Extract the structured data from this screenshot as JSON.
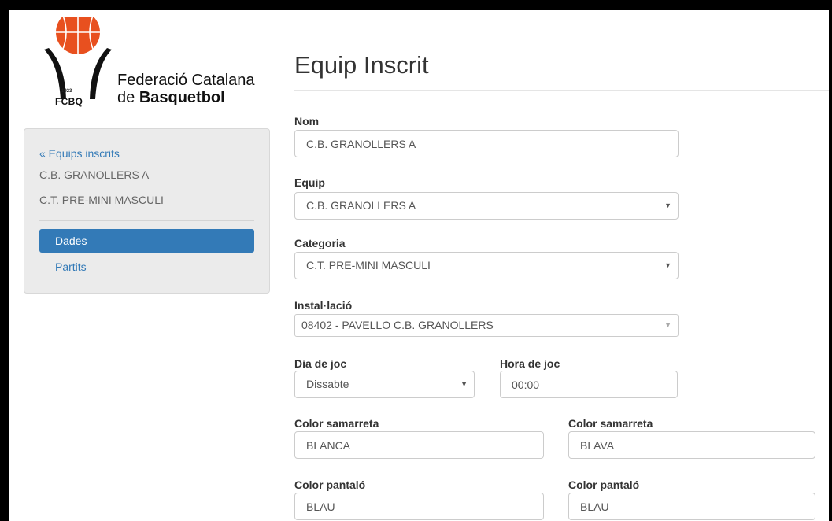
{
  "logo": {
    "year": "1923",
    "abbr": "FCBQ",
    "line1": "Federació Catalana",
    "line2_prefix": "de ",
    "line2_bold": "Basquetbol"
  },
  "sidebar": {
    "back_link": "« Equips inscrits",
    "team": "C.B. GRANOLLERS A",
    "category": "C.T. PRE-MINI MASCULI",
    "nav": [
      {
        "label": "Dades",
        "active": true
      },
      {
        "label": "Partits",
        "active": false
      }
    ]
  },
  "page": {
    "title": "Equip Inscrit"
  },
  "form": {
    "nom": {
      "label": "Nom",
      "value": "C.B. GRANOLLERS A"
    },
    "equip": {
      "label": "Equip",
      "value": "C.B. GRANOLLERS A"
    },
    "categoria": {
      "label": "Categoria",
      "value": "C.T. PRE-MINI MASCULI"
    },
    "installacio": {
      "label": "Instal·lació",
      "value": "08402 - PAVELLO C.B. GRANOLLERS"
    },
    "dia": {
      "label": "Dia de joc",
      "value": "Dissabte"
    },
    "hora": {
      "label": "Hora de joc",
      "value": "00:00"
    },
    "color_samarreta_1": {
      "label": "Color samarreta",
      "value": "BLANCA"
    },
    "color_samarreta_2": {
      "label": "Color samarreta",
      "value": "BLAVA"
    },
    "color_pantalo_1": {
      "label": "Color pantaló",
      "value": "BLAU"
    },
    "color_pantalo_2": {
      "label": "Color pantaló",
      "value": "BLAU"
    }
  },
  "colors": {
    "primary": "#337ab7",
    "ball": "#e8501f",
    "sidebar_bg": "#ebebeb"
  }
}
